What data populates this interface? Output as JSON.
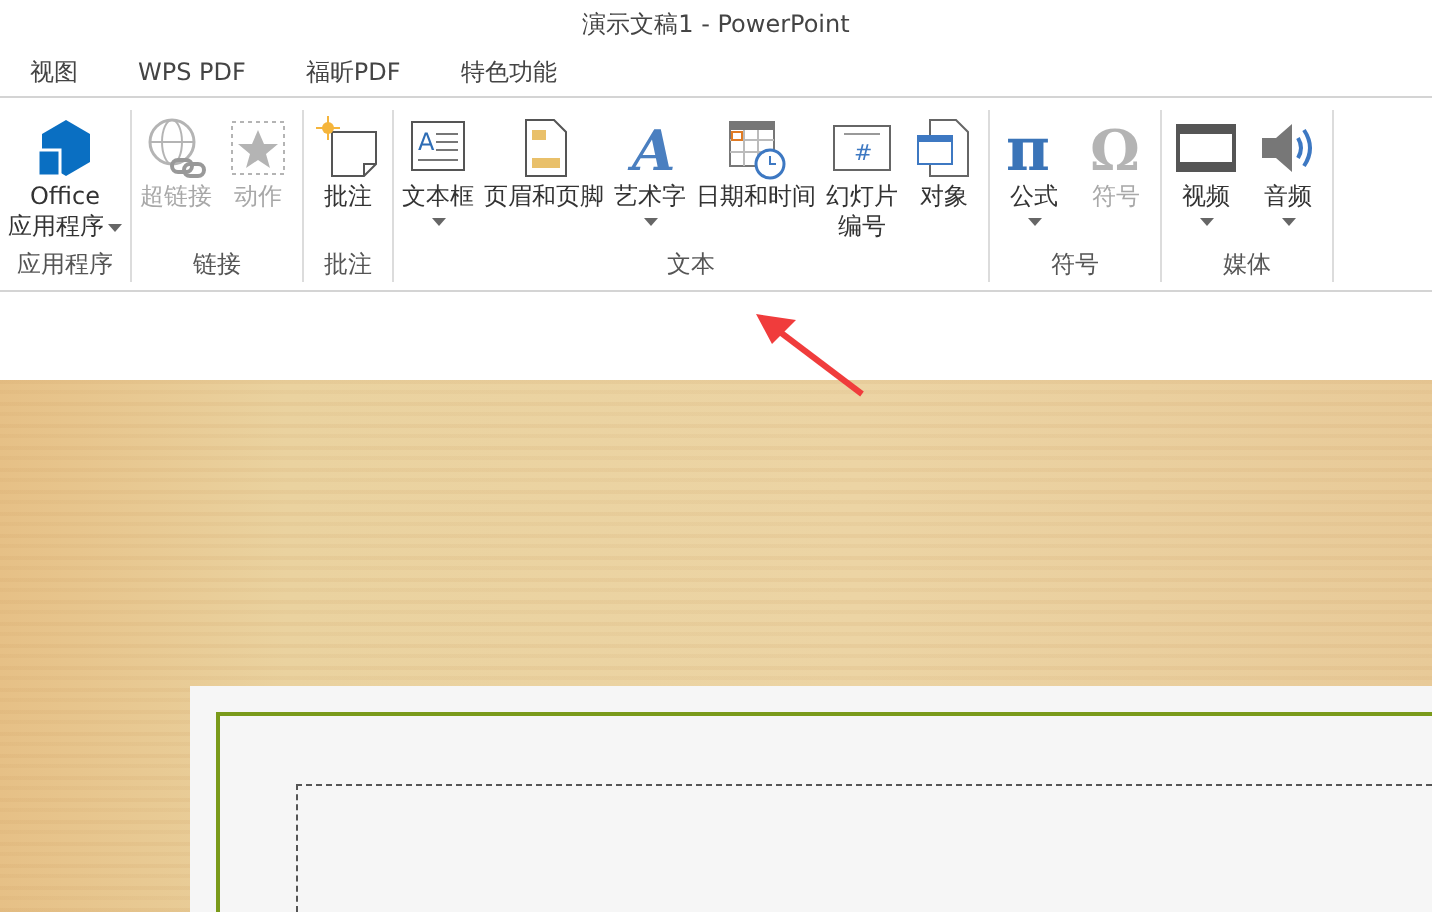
{
  "window": {
    "title": "演示文稿1 - PowerPoint"
  },
  "tabs": [
    {
      "label": "视图",
      "selected": false
    },
    {
      "label": "WPS PDF",
      "selected": false
    },
    {
      "label": "福昕PDF",
      "selected": false
    },
    {
      "label": "特色功能",
      "selected": false
    }
  ],
  "ribbon_groups": [
    {
      "label": "应用程序",
      "buttons": [
        {
          "kind": "office",
          "lines": [
            "Office",
            "应用程序"
          ],
          "dropdown": true,
          "disabled": false
        }
      ]
    },
    {
      "label": "链接",
      "buttons": [
        {
          "kind": "hyperlink",
          "lines": [
            "超链接"
          ],
          "dropdown": false,
          "disabled": true
        },
        {
          "kind": "action",
          "lines": [
            "动作"
          ],
          "dropdown": false,
          "disabled": true
        }
      ]
    },
    {
      "label": "批注",
      "buttons": [
        {
          "kind": "comment",
          "lines": [
            "批注"
          ],
          "dropdown": false,
          "disabled": false
        }
      ]
    },
    {
      "label": "文本",
      "buttons": [
        {
          "kind": "textbox",
          "glyph": "A",
          "lines": [
            "文本框"
          ],
          "dropdown": true,
          "disabled": false
        },
        {
          "kind": "header",
          "lines": [
            "页眉和页脚"
          ],
          "dropdown": false,
          "disabled": false
        },
        {
          "kind": "wordart",
          "glyph": "A",
          "lines": [
            "艺术字"
          ],
          "dropdown": true,
          "disabled": false
        },
        {
          "kind": "datetime",
          "lines": [
            "日期和时间"
          ],
          "dropdown": false,
          "disabled": false
        },
        {
          "kind": "slidenumber",
          "glyph": "#",
          "lines": [
            "幻灯片",
            "编号"
          ],
          "dropdown": false,
          "disabled": false
        },
        {
          "kind": "object",
          "lines": [
            "对象"
          ],
          "dropdown": false,
          "disabled": false
        }
      ]
    },
    {
      "label": "符号",
      "buttons": [
        {
          "kind": "equation",
          "glyph": "π",
          "lines": [
            "公式"
          ],
          "dropdown": true,
          "disabled": false
        },
        {
          "kind": "symbol",
          "glyph": "Ω",
          "lines": [
            "符号"
          ],
          "dropdown": false,
          "disabled": true
        }
      ]
    },
    {
      "label": "媒体",
      "buttons": [
        {
          "kind": "video",
          "lines": [
            "视频"
          ],
          "dropdown": true,
          "disabled": false
        },
        {
          "kind": "audio",
          "lines": [
            "音频"
          ],
          "dropdown": true,
          "disabled": false
        }
      ]
    }
  ]
}
